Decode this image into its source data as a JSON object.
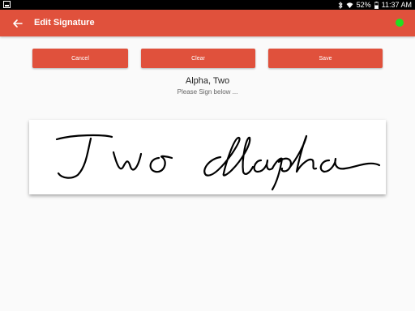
{
  "status_bar": {
    "battery": "52%",
    "time": "11:37 AM",
    "left_icon": "screenshot-icon",
    "icons": [
      "bluetooth-icon",
      "wifi-icon",
      "battery-icon"
    ]
  },
  "app_bar": {
    "title": "Edit Signature",
    "back_icon": "arrow-back-icon",
    "status_indicator_color": "#20e020",
    "color": "#e0513c"
  },
  "buttons": {
    "cancel": "Cancel",
    "clear": "Clear",
    "save": "Save"
  },
  "signer_name": "Alpha, Two",
  "prompt": "Please Sign below ...",
  "signature_text": "Two Alapha"
}
